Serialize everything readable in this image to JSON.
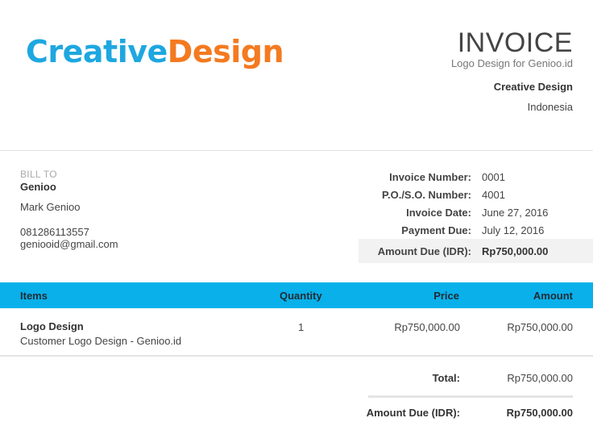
{
  "brand": {
    "part1": "Creative",
    "part2": "Design",
    "color1": "#1ea7e0",
    "color2": "#f47a20"
  },
  "header": {
    "title": "INVOICE",
    "subtitle": "Logo Design for Genioo.id",
    "company": "Creative Design",
    "country": "Indonesia"
  },
  "bill_to": {
    "label": "BILL TO",
    "name": "Genioo",
    "contact": "Mark Genioo",
    "phone": "081286113557",
    "email": "geniooid@gmail.com"
  },
  "meta": [
    {
      "label": "Invoice Number:",
      "value": "0001"
    },
    {
      "label": "P.O./S.O. Number:",
      "value": "4001"
    },
    {
      "label": "Invoice Date:",
      "value": "June 27, 2016"
    },
    {
      "label": "Payment Due:",
      "value": "July 12, 2016"
    },
    {
      "label": "Amount Due (IDR):",
      "value": "Rp750,000.00"
    }
  ],
  "table": {
    "header_color": "#0ab0ea",
    "columns": {
      "items": "Items",
      "quantity": "Quantity",
      "price": "Price",
      "amount": "Amount"
    },
    "rows": [
      {
        "name": "Logo Design",
        "description": "Customer Logo Design - Genioo.id",
        "quantity": "1",
        "price": "Rp750,000.00",
        "amount": "Rp750,000.00"
      }
    ]
  },
  "totals": {
    "total_label": "Total:",
    "total_value": "Rp750,000.00",
    "due_label": "Amount Due (IDR):",
    "due_value": "Rp750,000.00"
  }
}
